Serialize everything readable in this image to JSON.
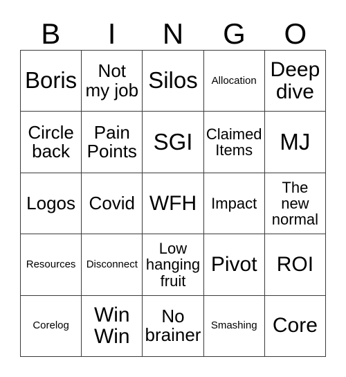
{
  "card": {
    "title": "BINGO",
    "header_letters": [
      "B",
      "I",
      "N",
      "G",
      "O"
    ],
    "grid_size": "5x5",
    "border_color": "#3a3a3a",
    "background_color": "#ffffff",
    "text_color": "#000000",
    "rows": [
      [
        {
          "text": "Boris",
          "size": "xl"
        },
        {
          "text": "Not\nmy job",
          "size": "md"
        },
        {
          "text": "Silos",
          "size": "xl"
        },
        {
          "text": "Allocation",
          "size": "xs"
        },
        {
          "text": "Deep\ndive",
          "size": "lg"
        }
      ],
      [
        {
          "text": "Circle\nback",
          "size": "md"
        },
        {
          "text": "Pain\nPoints",
          "size": "md"
        },
        {
          "text": "SGI",
          "size": "xl"
        },
        {
          "text": "Claimed\nItems",
          "size": "sm"
        },
        {
          "text": "MJ",
          "size": "xl"
        }
      ],
      [
        {
          "text": "Logos",
          "size": "md"
        },
        {
          "text": "Covid",
          "size": "md"
        },
        {
          "text": "WFH",
          "size": "lg"
        },
        {
          "text": "Impact",
          "size": "sm"
        },
        {
          "text": "The\nnew\nnormal",
          "size": "sm"
        }
      ],
      [
        {
          "text": "Resources",
          "size": "xs"
        },
        {
          "text": "Disconnect",
          "size": "xs"
        },
        {
          "text": "Low\nhanging\nfruit",
          "size": "sm"
        },
        {
          "text": "Pivot",
          "size": "lg"
        },
        {
          "text": "ROI",
          "size": "lg"
        }
      ],
      [
        {
          "text": "Corelog",
          "size": "xs"
        },
        {
          "text": "Win\nWin",
          "size": "lg"
        },
        {
          "text": "No\nbrainer",
          "size": "md"
        },
        {
          "text": "Smashing",
          "size": "xs"
        },
        {
          "text": "Core",
          "size": "lg"
        }
      ]
    ]
  }
}
